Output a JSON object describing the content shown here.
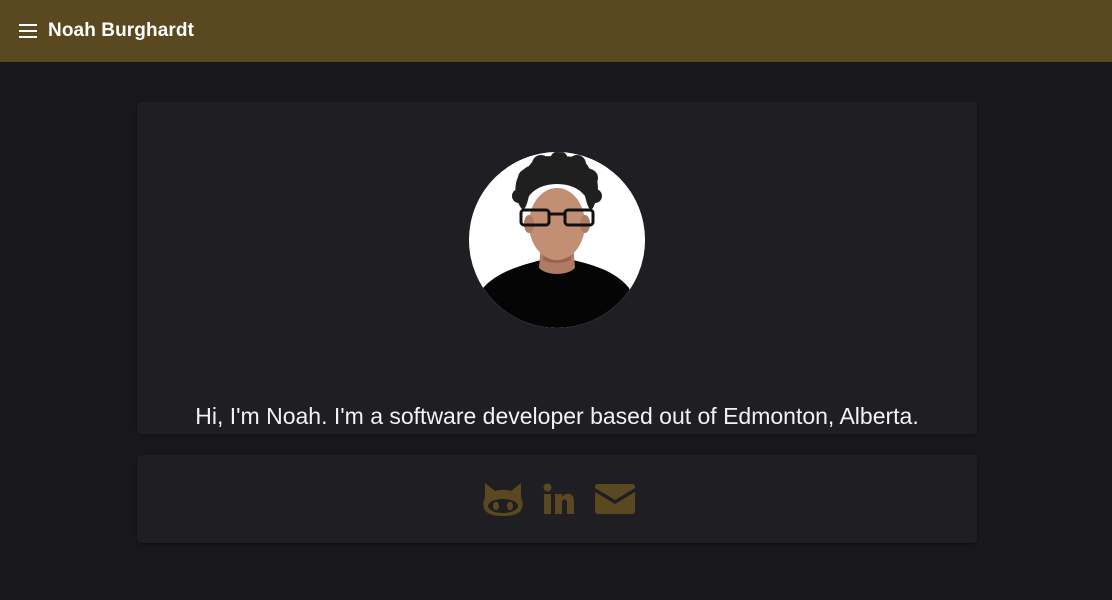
{
  "appbar": {
    "title": "Noah Burghardt",
    "menu_icon": "menu-icon"
  },
  "intro": {
    "avatar_icon": "avatar-illustration",
    "text": "Hi, I'm Noah. I'm a software developer based out of Edmonton, Alberta."
  },
  "social": {
    "links": [
      {
        "icon": "github-icon"
      },
      {
        "icon": "linkedin-icon"
      },
      {
        "icon": "email-icon"
      }
    ]
  },
  "colors": {
    "appbar": "#5a4920",
    "background": "#18171c",
    "card": "#1f1e23",
    "accent": "#5a4920",
    "text": "#f2f2f2"
  }
}
